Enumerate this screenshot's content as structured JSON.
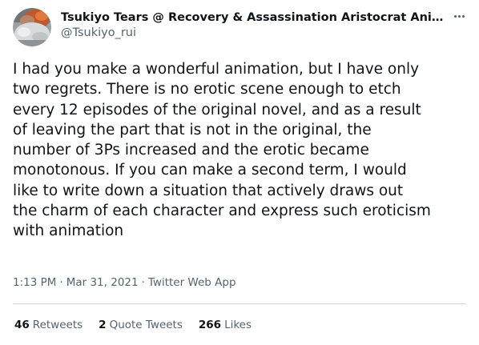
{
  "author": {
    "display_name": "Tsukiyo Tears @ Recovery & Assassination Aristocrat Animation...",
    "handle": "@Tsukiyo_rui",
    "avatar_icon": "avatar-photo-icon"
  },
  "more_icon": "more-options-icon",
  "tweet": {
    "text": "I had you make a wonderful animation, but I have only\ntwo regrets. There is no erotic scene enough to etch\nevery 12 episodes of the original novel, and as a result\nof leaving the part that is not in the original, the\nnumber of 3Ps increased and the erotic became\nmonotonous. If you can make a second term, I would\nlike to write down a situation that actively draws out\nthe charm of each character and express such eroticism\nwith animation"
  },
  "meta": {
    "time": "1:13 PM",
    "date": "Mar 31, 2021",
    "source": "Twitter Web App",
    "separator": "·"
  },
  "stats": {
    "retweets": {
      "count": "46",
      "label": "Retweets"
    },
    "quote_tweets": {
      "count": "2",
      "label": "Quote Tweets"
    },
    "likes": {
      "count": "266",
      "label": "Likes"
    }
  },
  "colors": {
    "text": "#0f1419",
    "secondary": "#536471",
    "divider": "#cfd9de"
  }
}
